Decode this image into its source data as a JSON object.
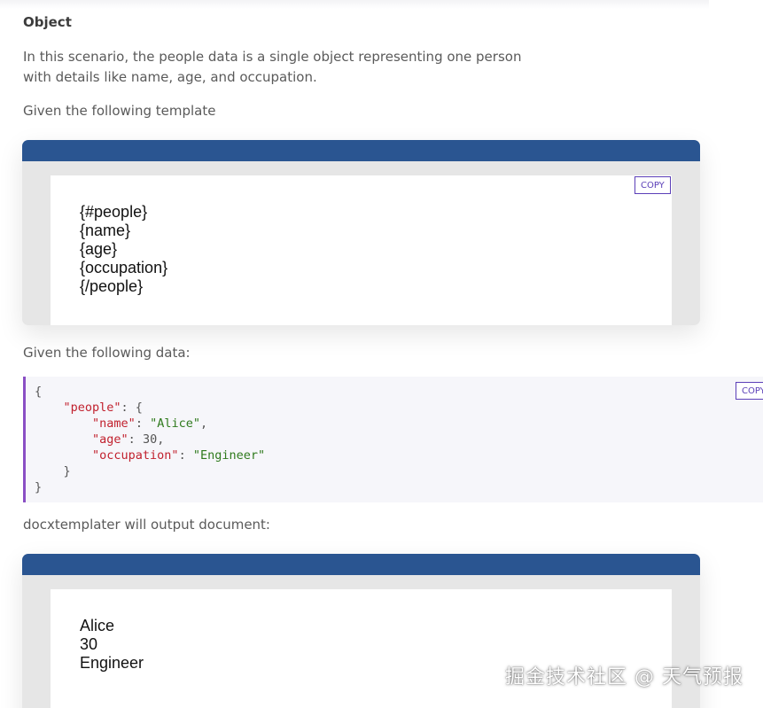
{
  "heading": "Object",
  "intro_line1": "In this scenario, the people data is a single object representing one person",
  "intro_line2": "with details like name, age, and occupation.",
  "template_label": "Given the following template",
  "template_lines": [
    "{#people}",
    "{name}",
    "{age}",
    "{occupation}",
    "{/people}"
  ],
  "data_label": "Given the following data:",
  "code": {
    "open_brace": "{",
    "people_key": "\"people\"",
    "name_key": "\"name\"",
    "name_val": "\"Alice\"",
    "age_key": "\"age\"",
    "age_val": "30",
    "occupation_key": "\"occupation\"",
    "occupation_val": "\"Engineer\"",
    "inner_close": "}",
    "close_brace": "}"
  },
  "output_label": "docxtemplater will output document:",
  "output_lines": [
    "Alice",
    "30",
    "Engineer"
  ],
  "copy_label": "COPY",
  "copy_label_cut": "COPY",
  "watermark": "掘金技术社区 @ 天气预报",
  "colors": {
    "doc_bar": "#2a5591",
    "code_accent": "#8a4fc4",
    "copy_button": "#5b3fb8",
    "json_key": "#c1212e",
    "json_string": "#2f7a1d"
  }
}
